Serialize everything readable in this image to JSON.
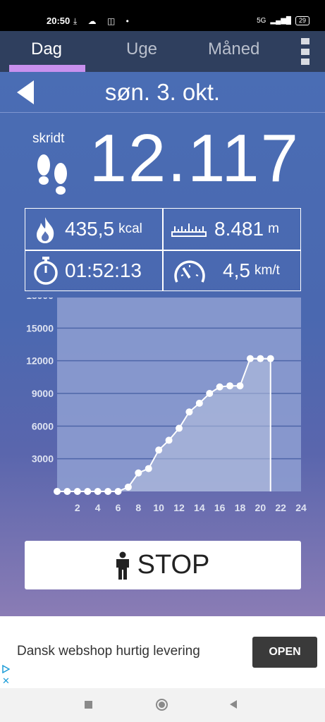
{
  "status_bar": {
    "time": "20:50",
    "icons_left": "⤓ ☁ ◫ •",
    "network": "5G",
    "signal": "▂▄▆█",
    "battery": "29"
  },
  "tabs": [
    {
      "label": "Dag",
      "active": true
    },
    {
      "label": "Uge",
      "active": false
    },
    {
      "label": "Måned",
      "active": false
    }
  ],
  "date": "søn. 3. okt.",
  "steps": {
    "label": "skridt",
    "value": "12.117"
  },
  "stats": {
    "calories": {
      "value": "435,5",
      "unit": "kcal"
    },
    "distance": {
      "value": "8.481",
      "unit": "m"
    },
    "duration": {
      "value": "01:52:13"
    },
    "speed": {
      "value": "4,5",
      "unit": "km/t"
    }
  },
  "chart_data": {
    "type": "area",
    "x": [
      0,
      1,
      2,
      3,
      4,
      5,
      6,
      7,
      8,
      9,
      10,
      11,
      12,
      13,
      14,
      15,
      16,
      17,
      18,
      19,
      20,
      21
    ],
    "values": [
      0,
      0,
      0,
      0,
      0,
      0,
      0,
      400,
      1700,
      2100,
      3800,
      4700,
      5800,
      7300,
      8100,
      9000,
      9600,
      9700,
      9700,
      12200,
      12200,
      12200
    ],
    "xticks": [
      2,
      4,
      6,
      8,
      10,
      12,
      14,
      16,
      18,
      20,
      22,
      24
    ],
    "yticks": [
      3000,
      6000,
      9000,
      12000,
      15000,
      18000
    ],
    "xlim": [
      0,
      24
    ],
    "ylim": [
      0,
      18000
    ],
    "grid": true,
    "colors": {
      "line": "#ffffff",
      "fill": "#b8c2e0",
      "plot_bg": "#8fa0d2"
    }
  },
  "stop_button": {
    "label": "STOP"
  },
  "ad": {
    "text": "Dansk webshop hurtig levering",
    "button": "OPEN",
    "close": "✕"
  }
}
